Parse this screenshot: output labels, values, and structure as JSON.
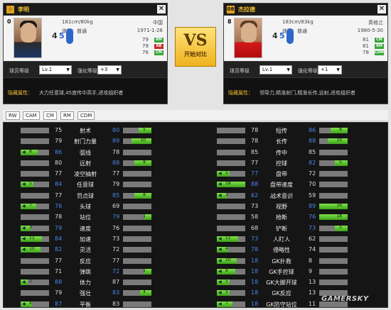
{
  "left_player": {
    "position_badge": "☆",
    "name": "李明",
    "jersey": "0",
    "height_weight": "181cm/80kg",
    "country": "中国",
    "body_type": "体型：普通",
    "birth": "1971-1-26",
    "weak_foot": "4",
    "strong_foot": "5",
    "positions": [
      {
        "value": "79",
        "tag": "RM",
        "color": "#3aa53a"
      },
      {
        "value": "79",
        "tag": "RB",
        "color": "#c42b2b"
      },
      {
        "value": "76",
        "tag": "CM",
        "color": "#3aa53a"
      }
    ],
    "level_label": "球员等级",
    "level_value": "Lv.1",
    "enhance_label": "强化等级",
    "enhance_value": "+3",
    "hidden_label": "隐藏属性：",
    "hidden_text": "大力任意球,45度传中高手,进攻组织者"
  },
  "right_player": {
    "position_badge": "08",
    "name": "杰拉德",
    "jersey": "8",
    "height_weight": "183cm/83kg",
    "country": "英格兰",
    "body_type": "体型：普通",
    "birth": "1980-5-30",
    "weak_foot": "4",
    "strong_foot": "5",
    "positions": [
      {
        "value": "81",
        "tag": "CM",
        "color": "#3aa53a"
      },
      {
        "value": "81",
        "tag": "RM",
        "color": "#3aa53a"
      },
      {
        "value": "78",
        "tag": "CDM",
        "color": "#3aa53a"
      }
    ],
    "level_label": "球员等级",
    "level_value": "Lv.1",
    "enhance_label": "强化等级",
    "enhance_value": "+1",
    "hidden_label": "隐藏属性：",
    "hidden_text": "领导力,精准射门,精准长传,远射,进攻组织者"
  },
  "vs": {
    "text": "VS",
    "subtitle": "开始对比"
  },
  "close_symbol": "✕",
  "tabs": [
    "RW",
    "CAM",
    "CM",
    "RM",
    "CDM"
  ],
  "stats_left": [
    {
      "name": "射术",
      "left": "75",
      "right": "80",
      "diff_side": "right",
      "diff": "5"
    },
    {
      "name": "射门力量",
      "left": "79",
      "right": "89",
      "diff_side": "right",
      "diff": "10"
    },
    {
      "name": "弧线",
      "left": "86",
      "right": "78",
      "diff_side": "left",
      "diff": "8"
    },
    {
      "name": "远射",
      "left": "80",
      "right": "88",
      "diff_side": "right",
      "diff": "8"
    },
    {
      "name": "凌空抽射",
      "left": "77",
      "right": "77",
      "diff_side": "",
      "diff": ""
    },
    {
      "name": "任意球",
      "left": "84",
      "right": "79",
      "diff_side": "left",
      "diff": "5"
    },
    {
      "name": "罚点球",
      "left": "77",
      "right": "85",
      "diff_side": "right",
      "diff": "8"
    },
    {
      "name": "头球",
      "left": "76",
      "right": "69",
      "diff_side": "left",
      "diff": "7"
    },
    {
      "name": "站位",
      "left": "78",
      "right": "79",
      "diff_side": "right",
      "diff": "1"
    },
    {
      "name": "速度",
      "left": "79",
      "right": "76",
      "diff_side": "left",
      "diff": "3"
    },
    {
      "name": "加速",
      "left": "84",
      "right": "73",
      "diff_side": "left",
      "diff": "11"
    },
    {
      "name": "灵活",
      "left": "82",
      "right": "72",
      "diff_side": "left",
      "diff": "10"
    },
    {
      "name": "反应",
      "left": "77",
      "right": "77",
      "diff_side": "",
      "diff": ""
    },
    {
      "name": "弹跳",
      "left": "71",
      "right": "72",
      "diff_side": "right",
      "diff": "1"
    },
    {
      "name": "体力",
      "left": "88",
      "right": "87",
      "diff_side": "left",
      "diff": "1"
    },
    {
      "name": "强壮",
      "left": "79",
      "right": "83",
      "diff_side": "right",
      "diff": "4"
    },
    {
      "name": "平衡",
      "left": "87",
      "right": "83",
      "diff_side": "left",
      "diff": "4"
    }
  ],
  "stats_right": [
    {
      "name": "短传",
      "left": "78",
      "right": "86",
      "diff_side": "right",
      "diff": "8"
    },
    {
      "name": "长传",
      "left": "78",
      "right": "88",
      "diff_side": "right",
      "diff": "10"
    },
    {
      "name": "传中",
      "left": "85",
      "right": "85",
      "diff_side": "",
      "diff": ""
    },
    {
      "name": "控球",
      "left": "77",
      "right": "82",
      "diff_side": "right",
      "diff": "5"
    },
    {
      "name": "盘带",
      "left": "77",
      "right": "72",
      "diff_side": "left",
      "diff": "5"
    },
    {
      "name": "盘带速度",
      "left": "88",
      "right": "70",
      "diff_side": "left",
      "diff": "18"
    },
    {
      "name": "战术意识",
      "left": "62",
      "right": "59",
      "diff_side": "left",
      "diff": "3"
    },
    {
      "name": "视野",
      "left": "73",
      "right": "89",
      "diff_side": "right",
      "diff": "16"
    },
    {
      "name": "抢断",
      "left": "58",
      "right": "76",
      "diff_side": "right",
      "diff": "18"
    },
    {
      "name": "铲断",
      "left": "68",
      "right": "73",
      "diff_side": "right",
      "diff": "5"
    },
    {
      "name": "人盯人",
      "left": "73",
      "right": "62",
      "diff_side": "left",
      "diff": "11"
    },
    {
      "name": "侵略性",
      "left": "78",
      "right": "74",
      "diff_side": "left",
      "diff": "4"
    },
    {
      "name": "GK扑救",
      "left": "18",
      "right": "8",
      "diff_side": "left",
      "diff": "10"
    },
    {
      "name": "GK手控球",
      "left": "18",
      "right": "9",
      "diff_side": "left",
      "diff": "9"
    },
    {
      "name": "GK大脚开球",
      "left": "18",
      "right": "13",
      "diff_side": "left",
      "diff": "5"
    },
    {
      "name": "GK反应",
      "left": "18",
      "right": "13",
      "diff_side": "left",
      "diff": "5"
    },
    {
      "name": "GK防守站位",
      "left": "18",
      "right": "11",
      "diff_side": "left",
      "diff": "7"
    }
  ],
  "watermark": "GAMERSKY"
}
